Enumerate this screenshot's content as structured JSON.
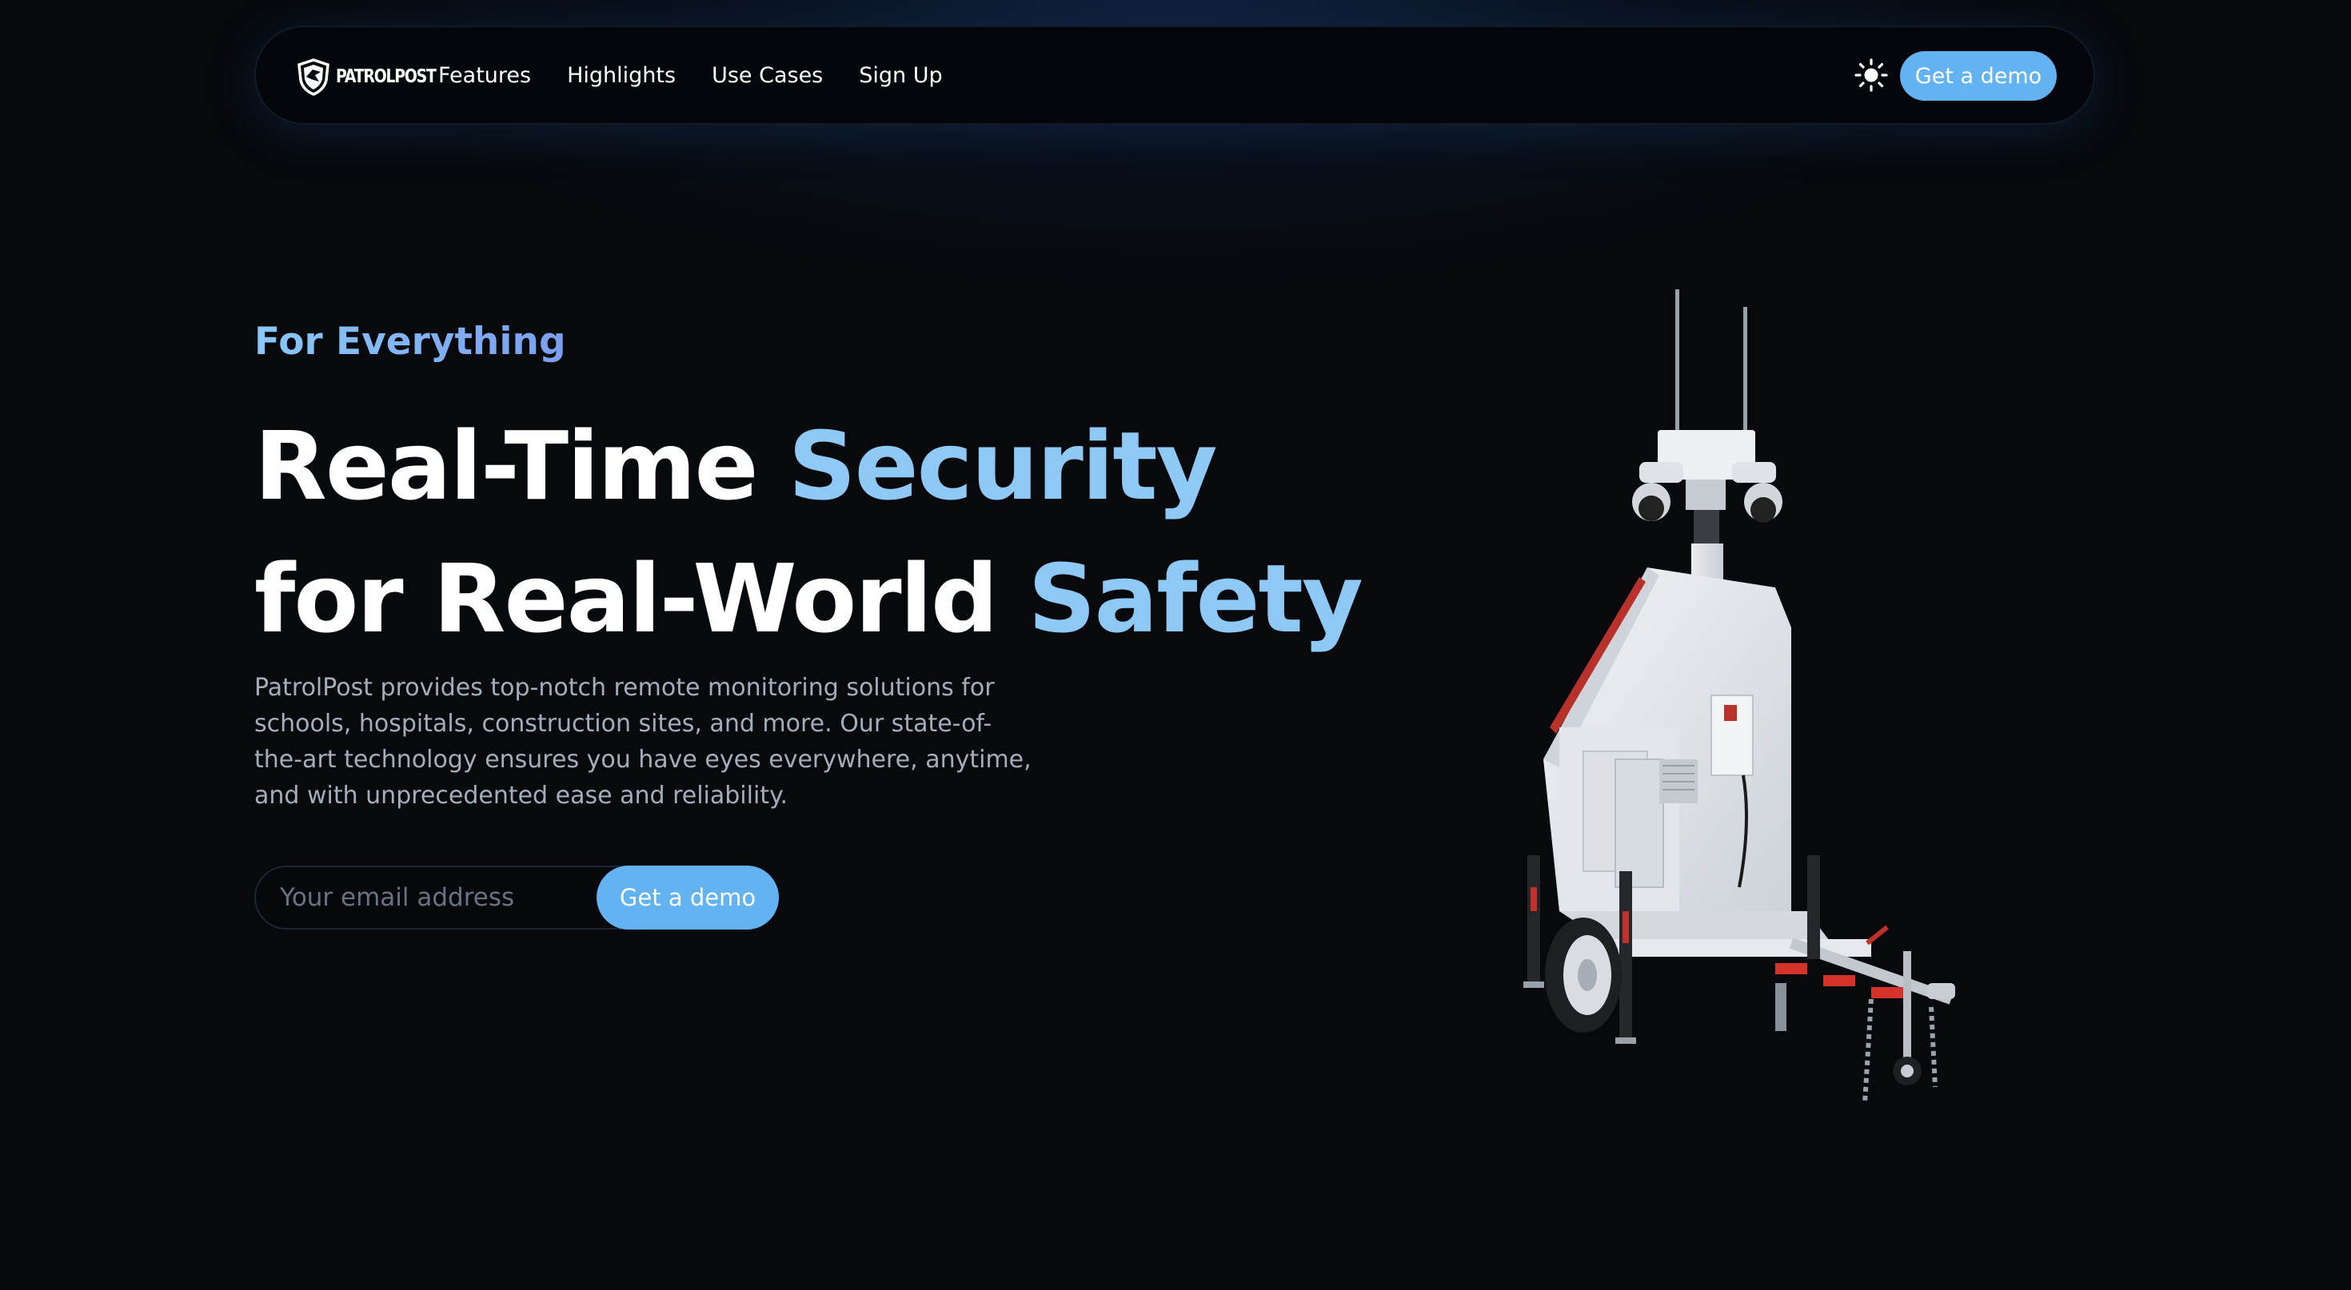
{
  "brand": {
    "logo_text": "PATROLPOST"
  },
  "nav": {
    "links": [
      "Features",
      "Highlights",
      "Use Cases",
      "Sign Up"
    ],
    "cta_label": "Get a demo",
    "theme_icon": "sun-icon"
  },
  "hero": {
    "eyebrow": "For Everything",
    "headline_line1_plain": "Real-Time ",
    "headline_line1_accent": "Security",
    "headline_line2_plain": "for Real-World ",
    "headline_line2_accent": "Safety",
    "description": "PatrolPost provides top-notch remote monitoring solutions for schools, hospitals, construction sites, and more. Our state-of-the-art technology ensures you have eyes everywhere, anytime, and with unprecedented ease and reliability.",
    "email_placeholder": "Your email address",
    "email_value": "",
    "submit_label": "Get a demo",
    "image": "mobile-surveillance-trailer"
  },
  "colors": {
    "background": "#07090d",
    "accent": "#63b3f3",
    "headline_accent": "#8ec9f6",
    "body_text": "#a6adba"
  }
}
